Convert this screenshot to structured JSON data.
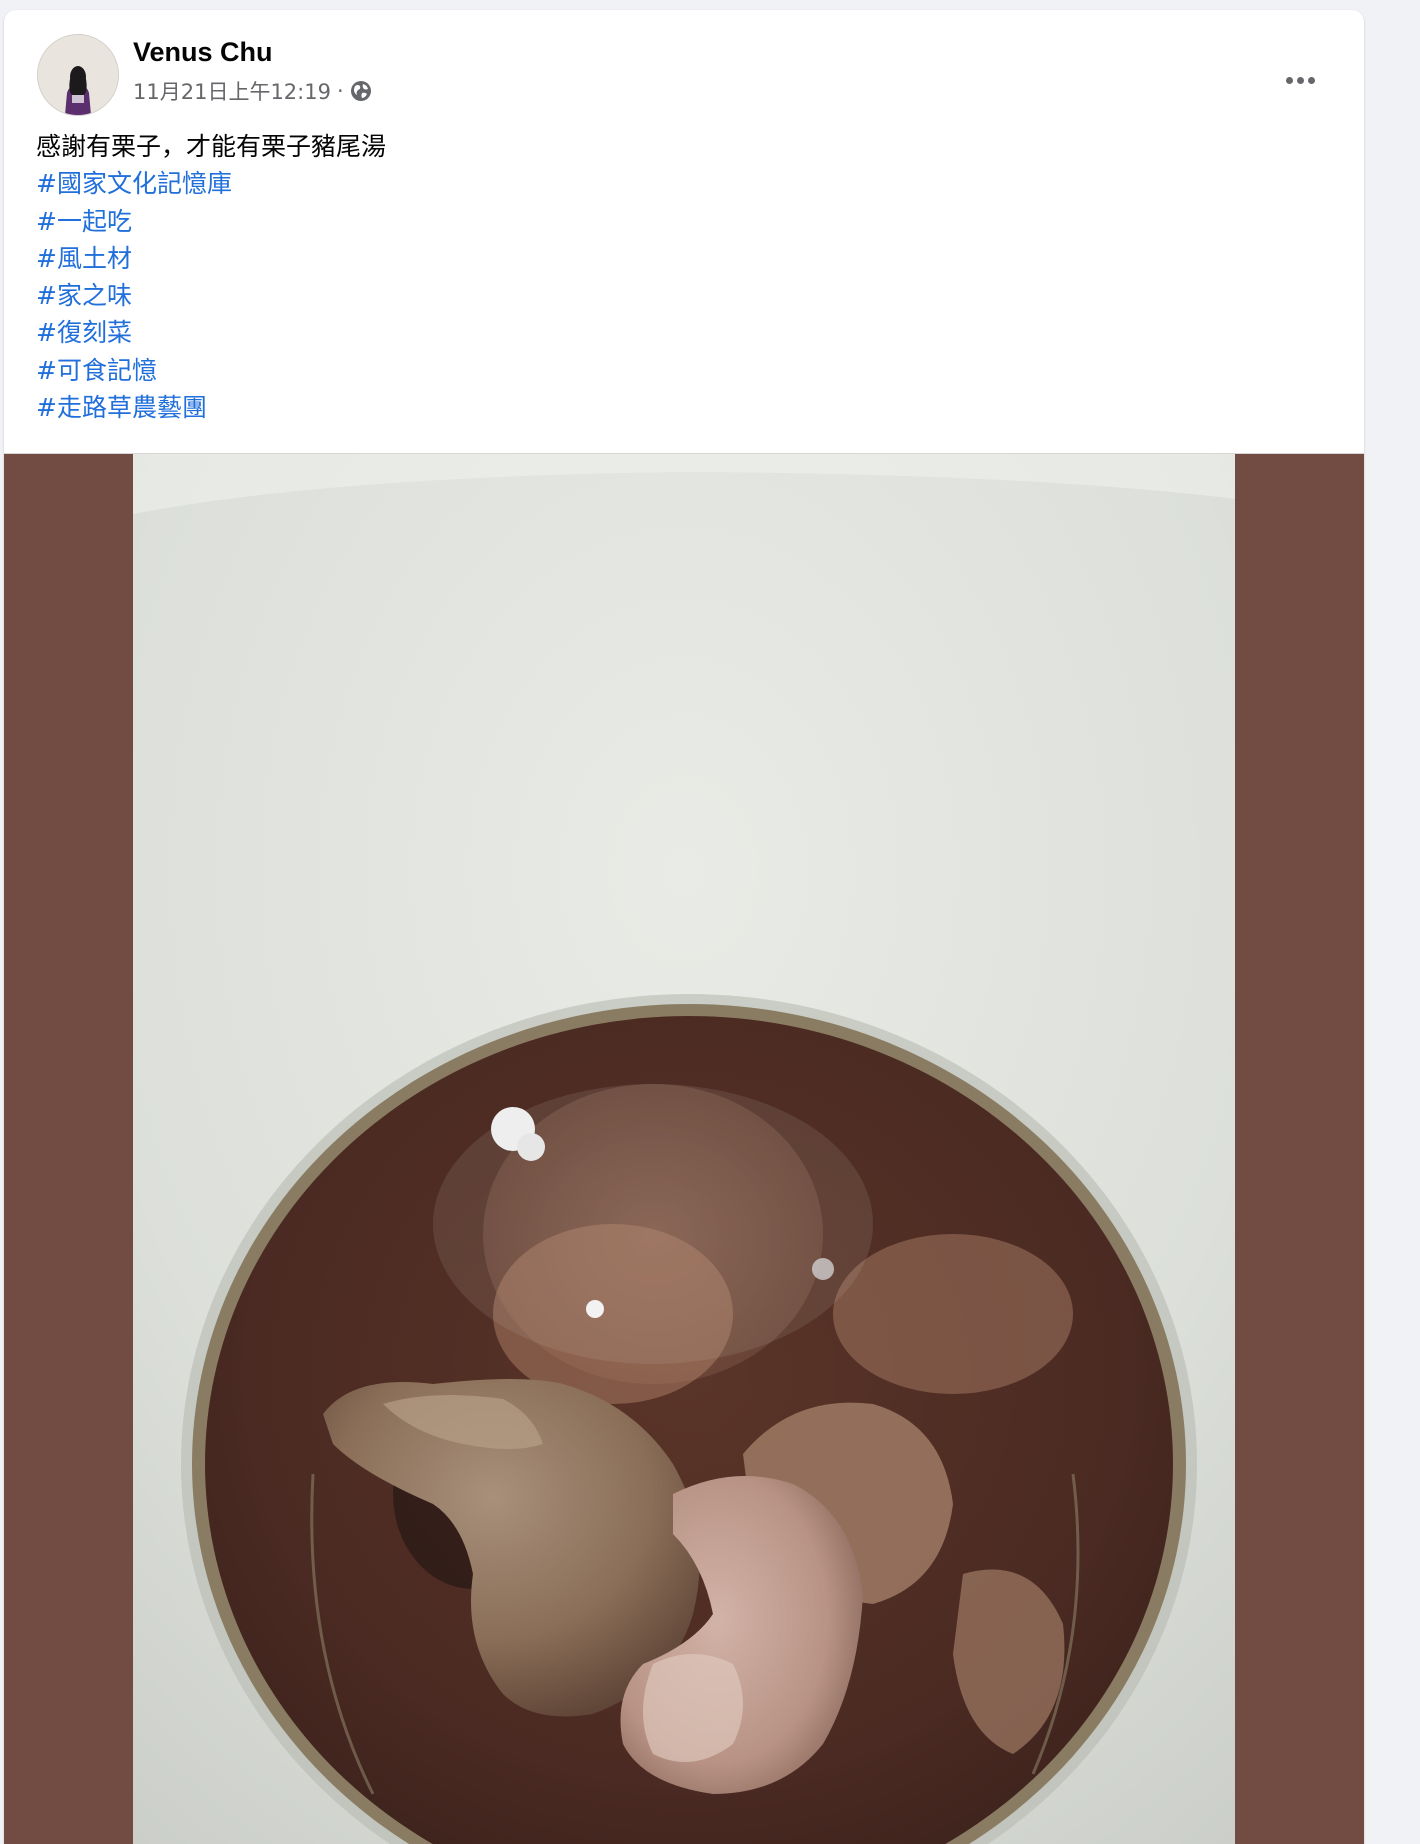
{
  "post": {
    "author_name": "Venus Chu",
    "timestamp": "11月21日上午12:19",
    "meta_separator": "·",
    "privacy_icon": "globe-icon",
    "more_icon": "more-horizontal-icon",
    "caption": "感謝有栗子，才能有栗子豬尾湯",
    "hashtags": [
      "#國家文化記憶庫",
      "#一起吃",
      "#風土材",
      "#家之味",
      "#復刻菜",
      "#可食記憶",
      "#走路草農藝團"
    ],
    "photo": {
      "subject": "chestnut-pork-tail-soup",
      "pillarbox_color": "#724c42"
    }
  },
  "colors": {
    "hashtag": "#216fdb",
    "author": "#050505",
    "meta": "#65676b",
    "page_background": "#f0f2f5",
    "card_background": "#ffffff"
  }
}
